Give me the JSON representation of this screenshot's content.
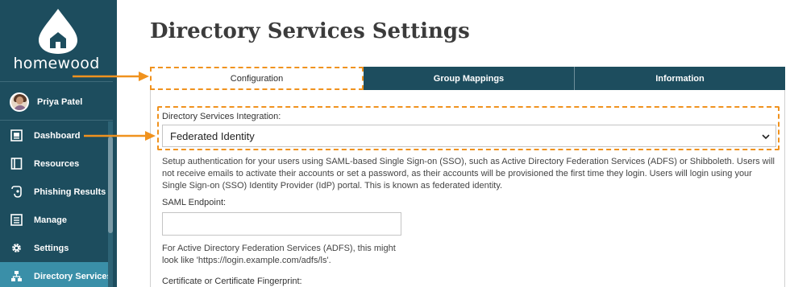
{
  "app": {
    "logo_text": "homewood"
  },
  "user": {
    "name": "Priya Patel"
  },
  "sidebar": {
    "items": [
      {
        "label": "Dashboard",
        "icon": "dashboard-icon"
      },
      {
        "label": "Resources",
        "icon": "book-icon"
      },
      {
        "label": "Phishing Results",
        "icon": "hook-icon"
      },
      {
        "label": "Manage",
        "icon": "list-icon"
      },
      {
        "label": "Settings",
        "icon": "gear-icon"
      },
      {
        "label": "Directory Services",
        "icon": "directory-icon",
        "active": true
      }
    ]
  },
  "main": {
    "title": "Directory Services Settings",
    "tabs": [
      {
        "label": "Configuration",
        "active": true
      },
      {
        "label": "Group Mappings"
      },
      {
        "label": "Information"
      }
    ],
    "integration": {
      "label": "Directory Services Integration:",
      "selected": "Federated Identity"
    },
    "description": "Setup authentication for your users using SAML-based Single Sign-on (SSO), such as Active Directory Federation Services (ADFS) or Shibboleth. Users will not receive emails to activate their accounts or set a password, as their accounts will be provisioned the first time they login. Users will login using your Single Sign-on (SSO) Identity Provider (IdP) portal. This is known as federated identity.",
    "saml": {
      "label": "SAML Endpoint:",
      "value": "",
      "hint": "For Active Directory Federation Services (ADFS), this might look like 'https://login.example.com/adfs/ls'."
    },
    "certificate": {
      "label": "Certificate or Certificate Fingerprint:"
    }
  },
  "colors": {
    "sidebar_bg": "#1d4d5e",
    "active_nav": "#3a8fa8",
    "accent_orange": "#f0921e"
  }
}
